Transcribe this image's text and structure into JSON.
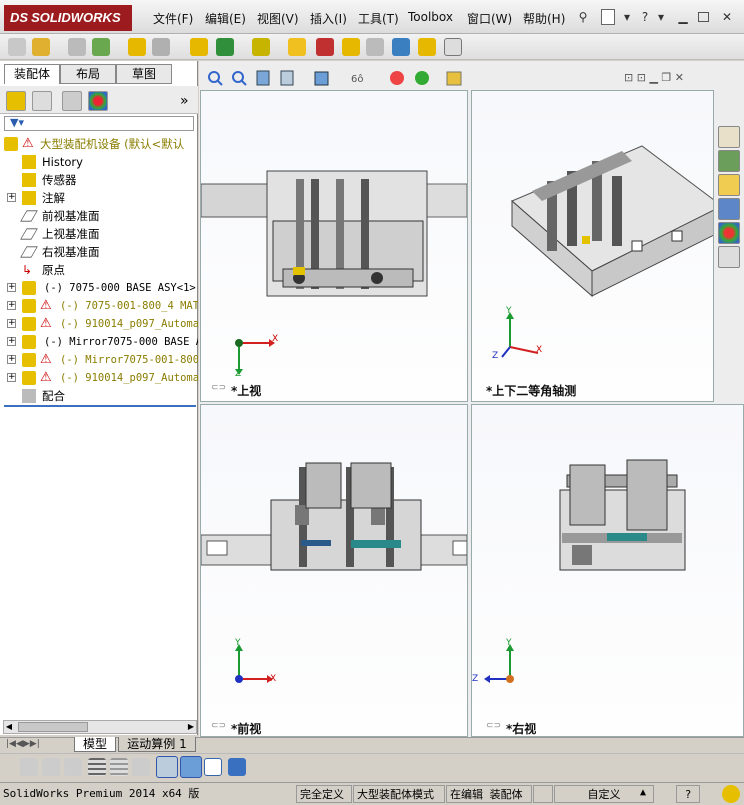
{
  "app": {
    "logo_ds": "DS",
    "logo_text": "SOLIDWORKS"
  },
  "menu": [
    "文件(F)",
    "编辑(E)",
    "视图(V)",
    "插入(I)",
    "工具(T)",
    "Toolbox",
    "窗口(W)",
    "帮助(H)"
  ],
  "panel_tabs": [
    "装配体",
    "布局",
    "草图"
  ],
  "tree": {
    "root": "大型装配机设备  (默认<默认",
    "items": [
      {
        "label": "History",
        "icon": "history-icon",
        "expand": "",
        "warn": false
      },
      {
        "label": "传感器",
        "icon": "sensor-icon",
        "expand": "",
        "warn": false
      },
      {
        "label": "注解",
        "icon": "annotation-icon",
        "expand": "+",
        "warn": false
      },
      {
        "label": "前视基准面",
        "icon": "plane-icon",
        "expand": "",
        "warn": false
      },
      {
        "label": "上视基准面",
        "icon": "plane-icon",
        "expand": "",
        "warn": false
      },
      {
        "label": "右视基准面",
        "icon": "plane-icon",
        "expand": "",
        "warn": false
      },
      {
        "label": "原点",
        "icon": "origin-icon",
        "expand": "",
        "warn": false
      },
      {
        "label": "(-) 7075-000 BASE ASY<1>",
        "icon": "assembly-icon",
        "expand": "+",
        "warn": false
      },
      {
        "label": "(-) 7075-001-800_4 MAT",
        "icon": "assembly-icon",
        "expand": "+",
        "warn": true
      },
      {
        "label": "(-) 910014_p097_Automat",
        "icon": "assembly-icon",
        "expand": "+",
        "warn": true
      },
      {
        "label": "(-) Mirror7075-000 BASE AS",
        "icon": "assembly-icon",
        "expand": "+",
        "warn": false
      },
      {
        "label": "(-) Mirror7075-001-800<",
        "icon": "assembly-icon",
        "expand": "+",
        "warn": true
      },
      {
        "label": "(-) 910014_p097_Automat",
        "icon": "assembly-icon",
        "expand": "+",
        "warn": true
      },
      {
        "label": "配合",
        "icon": "mates-icon",
        "expand": "",
        "warn": false
      }
    ]
  },
  "viewports": [
    {
      "label": "*上视",
      "triad": {
        "a": "X",
        "b": "Z"
      }
    },
    {
      "label": "*上下二等角轴测",
      "triad": {
        "a": "Y",
        "b": "X",
        "c": "Z"
      }
    },
    {
      "label": "*前视",
      "triad": {
        "a": "Y",
        "b": "X"
      }
    },
    {
      "label": "*右视",
      "triad": {
        "a": "Y",
        "b": "Z"
      }
    }
  ],
  "bottom_tabs": [
    "模型",
    "运动算例 1"
  ],
  "status": {
    "product": "SolidWorks Premium 2014 x64 版",
    "state": "完全定义",
    "mode": "大型装配体模式",
    "editing": "在编辑 装配体",
    "units": "自定义",
    "help": "?"
  },
  "colors": {
    "brand": "#9b1b1e",
    "warning": "#e6b800",
    "x_axis": "#d22020",
    "y_axis": "#1a9a30",
    "z_axis": "#2030c0"
  }
}
